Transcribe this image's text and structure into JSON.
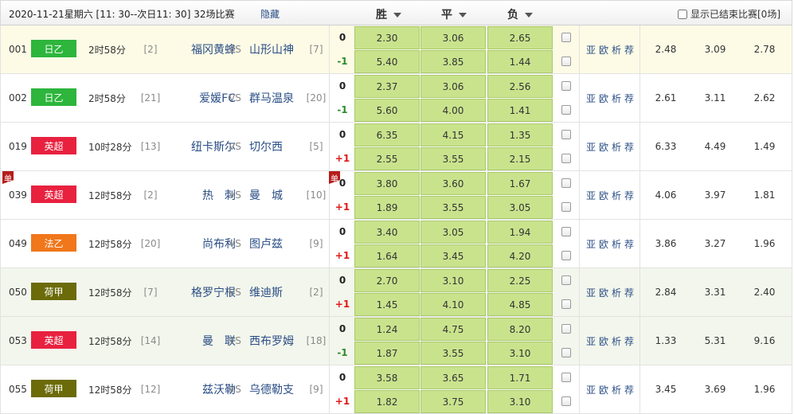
{
  "header": {
    "date_range": "2020-11-21星期六 [11: 30--次日11: 30]",
    "count": "32场比赛",
    "hide_label": "隐藏",
    "col_win": "胜",
    "col_draw": "平",
    "col_lose": "负",
    "show_finished": "显示已结束比赛[0场]"
  },
  "link_labels": {
    "asia": "亚",
    "euro": "欧",
    "analysis": "析",
    "tip": "荐"
  },
  "dan_label": "单",
  "colors": {
    "j2": "#2db53c",
    "epl": "#e8213f",
    "fr2": "#f0771a",
    "nl": "#6b6b0a",
    "odds_bg": "#c9e38d"
  },
  "matches": [
    {
      "num": "001",
      "league": "日乙",
      "league_color": "#2db53c",
      "time": "2时58分",
      "home_rank": "[2]",
      "home": "福冈黄蜂",
      "vs": "VS",
      "away": "山形山神",
      "away_rank": "[7]",
      "hc1": "0",
      "o1": [
        "2.30",
        "3.06",
        "2.65"
      ],
      "hc2": "-1",
      "o2": [
        "5.40",
        "3.85",
        "1.44"
      ],
      "avg": [
        "2.48",
        "3.09",
        "2.78"
      ],
      "bg": "#fdfbe6"
    },
    {
      "num": "002",
      "league": "日乙",
      "league_color": "#2db53c",
      "time": "2时58分",
      "home_rank": "[21]",
      "home": "爱媛FC",
      "vs": "VS",
      "away": "群马温泉",
      "away_rank": "[20]",
      "hc1": "0",
      "o1": [
        "2.37",
        "3.06",
        "2.56"
      ],
      "hc2": "-1",
      "o2": [
        "5.60",
        "4.00",
        "1.41"
      ],
      "avg": [
        "2.61",
        "3.11",
        "2.62"
      ],
      "bg": "#ffffff"
    },
    {
      "num": "019",
      "league": "英超",
      "league_color": "#e8213f",
      "time": "10时28分",
      "home_rank": "[13]",
      "home": "纽卡斯尔",
      "vs": "VS",
      "away": "切尔西",
      "away_rank": "[5]",
      "hc1": "0",
      "o1": [
        "6.35",
        "4.15",
        "1.35"
      ],
      "hc2": "+1",
      "o2": [
        "2.55",
        "3.55",
        "2.15"
      ],
      "avg": [
        "6.33",
        "4.49",
        "1.49"
      ],
      "bg": "#ffffff"
    },
    {
      "num": "039",
      "league": "英超",
      "league_color": "#e8213f",
      "time": "12时58分",
      "home_rank": "[2]",
      "home": "热　刺",
      "vs": "VS",
      "away": "曼　城",
      "away_rank": "[10]",
      "hc1": "0",
      "o1": [
        "3.80",
        "3.60",
        "1.67"
      ],
      "hc2": "+1",
      "o2": [
        "1.89",
        "3.55",
        "3.05"
      ],
      "avg": [
        "4.06",
        "3.97",
        "1.81"
      ],
      "bg": "#ffffff"
    },
    {
      "num": "049",
      "league": "法乙",
      "league_color": "#f0771a",
      "time": "12时58分",
      "home_rank": "[20]",
      "home": "尚布利",
      "vs": "VS",
      "away": "图卢兹",
      "away_rank": "[9]",
      "hc1": "0",
      "o1": [
        "3.40",
        "3.05",
        "1.94"
      ],
      "hc2": "+1",
      "o2": [
        "1.64",
        "3.45",
        "4.20"
      ],
      "avg": [
        "3.86",
        "3.27",
        "1.96"
      ],
      "bg": "#ffffff"
    },
    {
      "num": "050",
      "league": "荷甲",
      "league_color": "#6b6b0a",
      "time": "12时58分",
      "home_rank": "[7]",
      "home": "格罗宁根",
      "vs": "VS",
      "away": "维迪斯",
      "away_rank": "[2]",
      "hc1": "0",
      "o1": [
        "2.70",
        "3.10",
        "2.25"
      ],
      "hc2": "+1",
      "o2": [
        "1.45",
        "4.10",
        "4.85"
      ],
      "avg": [
        "2.84",
        "3.31",
        "2.40"
      ],
      "bg": "#f3f6ec"
    },
    {
      "num": "053",
      "league": "英超",
      "league_color": "#e8213f",
      "time": "12时58分",
      "home_rank": "[14]",
      "home": "曼　联",
      "vs": "VS",
      "away": "西布罗姆",
      "away_rank": "[18]",
      "hc1": "0",
      "o1": [
        "1.24",
        "4.75",
        "8.20"
      ],
      "hc2": "-1",
      "o2": [
        "1.87",
        "3.55",
        "3.10"
      ],
      "avg": [
        "1.33",
        "5.31",
        "9.16"
      ],
      "bg": "#f3f6ec"
    },
    {
      "num": "055",
      "league": "荷甲",
      "league_color": "#6b6b0a",
      "time": "12时58分",
      "home_rank": "[12]",
      "home": "兹沃勒",
      "vs": "VS",
      "away": "乌德勒支",
      "away_rank": "[9]",
      "hc1": "0",
      "o1": [
        "3.58",
        "3.65",
        "1.71"
      ],
      "hc2": "+1",
      "o2": [
        "1.82",
        "3.75",
        "3.10"
      ],
      "avg": [
        "3.45",
        "3.69",
        "1.96"
      ],
      "bg": "#ffffff"
    }
  ]
}
